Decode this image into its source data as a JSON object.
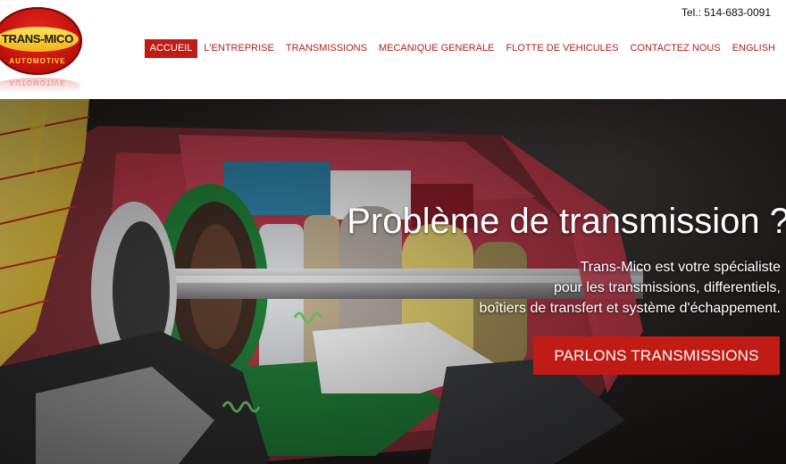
{
  "brand": {
    "logo_text": "TRANS-MICO",
    "logo_sub": "AUTOMOTIVE",
    "colors": {
      "accent": "#c01b14",
      "logo_red": "#d81a12",
      "logo_yellow": "#f5c529"
    }
  },
  "header": {
    "phone": "Tel.: 514-683-0091",
    "nav": [
      {
        "label": "ACCUEIL",
        "active": true
      },
      {
        "label": "L'ENTREPRISE"
      },
      {
        "label": "TRANSMISSIONS"
      },
      {
        "label": "MECANIQUE GENERALE"
      },
      {
        "label": "FLOTTE DE VEHICULES"
      },
      {
        "label": "CONTACTEZ NOUS"
      },
      {
        "label": "ENGLISH"
      }
    ]
  },
  "hero": {
    "title": "Problème de transmission ?",
    "lines": [
      "Trans-Mico est votre spécialiste",
      "pour les transmissions, differentiels,",
      "boîtiers de transfert et système d'échappement."
    ],
    "cta_label": "PARLONS TRANSMISSIONS",
    "image": "transmission-cutaway-photo"
  }
}
